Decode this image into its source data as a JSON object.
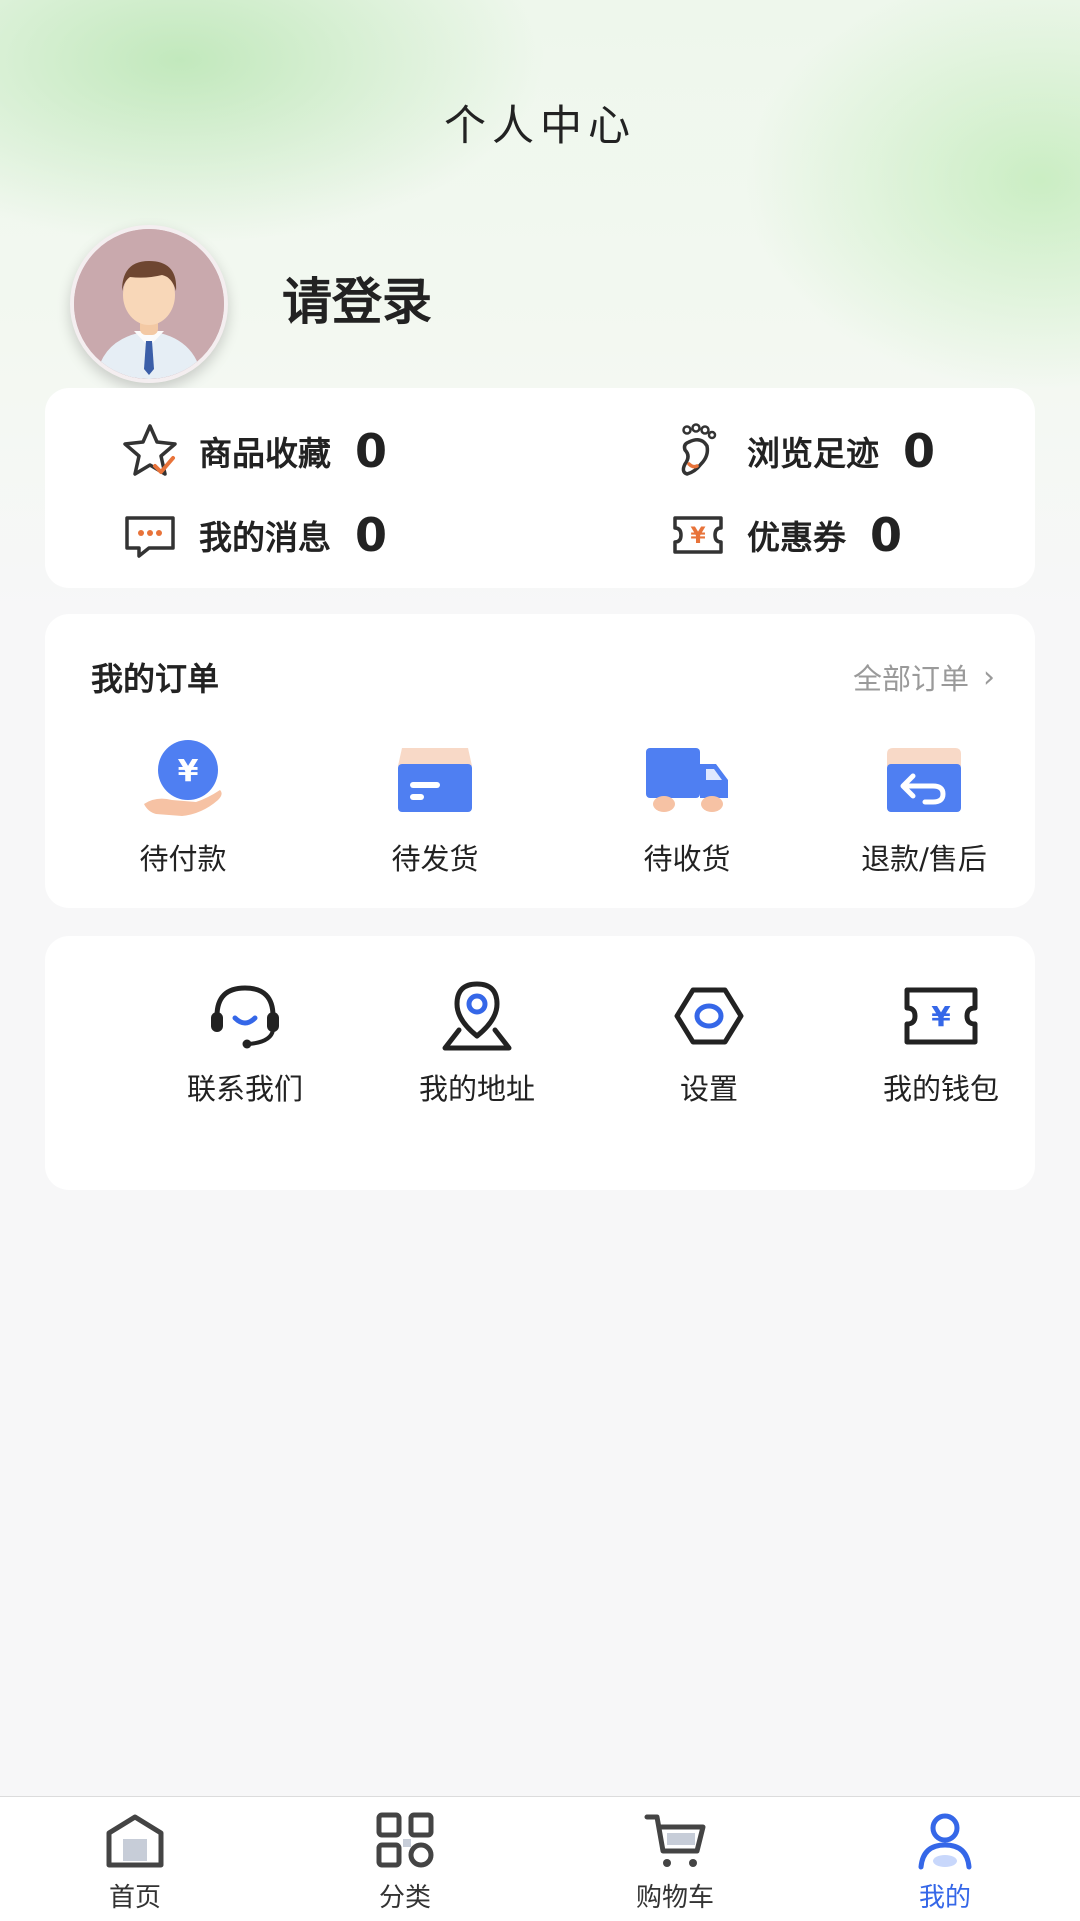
{
  "header": {
    "title": "个人中心"
  },
  "profile": {
    "login_prompt": "请登录"
  },
  "stats": [
    {
      "label": "商品收藏",
      "value": "0",
      "icon": "star-icon"
    },
    {
      "label": "浏览足迹",
      "value": "0",
      "icon": "footprint-icon"
    },
    {
      "label": "我的消息",
      "value": "0",
      "icon": "message-icon"
    },
    {
      "label": "优惠券",
      "value": "0",
      "icon": "coupon-icon"
    }
  ],
  "orders": {
    "title": "我的订单",
    "all_label": "全部订单",
    "items": [
      {
        "label": "待付款",
        "icon": "payment-icon"
      },
      {
        "label": "待发货",
        "icon": "box-icon"
      },
      {
        "label": "待收货",
        "icon": "truck-icon"
      },
      {
        "label": "退款/售后",
        "icon": "refund-icon"
      }
    ]
  },
  "tools": [
    {
      "label": "联系我们",
      "icon": "headset-icon"
    },
    {
      "label": "我的地址",
      "icon": "location-icon"
    },
    {
      "label": "设置",
      "icon": "settings-icon"
    },
    {
      "label": "我的钱包",
      "icon": "wallet-icon"
    }
  ],
  "tabbar": [
    {
      "label": "首页",
      "icon": "home-icon",
      "active": false
    },
    {
      "label": "分类",
      "icon": "category-icon",
      "active": false
    },
    {
      "label": "购物车",
      "icon": "cart-icon",
      "active": false
    },
    {
      "label": "我的",
      "icon": "user-icon",
      "active": true
    }
  ],
  "colors": {
    "accent": "#3567e8",
    "accent_light": "#5b8cf5",
    "orange": "#e8733a",
    "background": "#f7f7f8"
  }
}
